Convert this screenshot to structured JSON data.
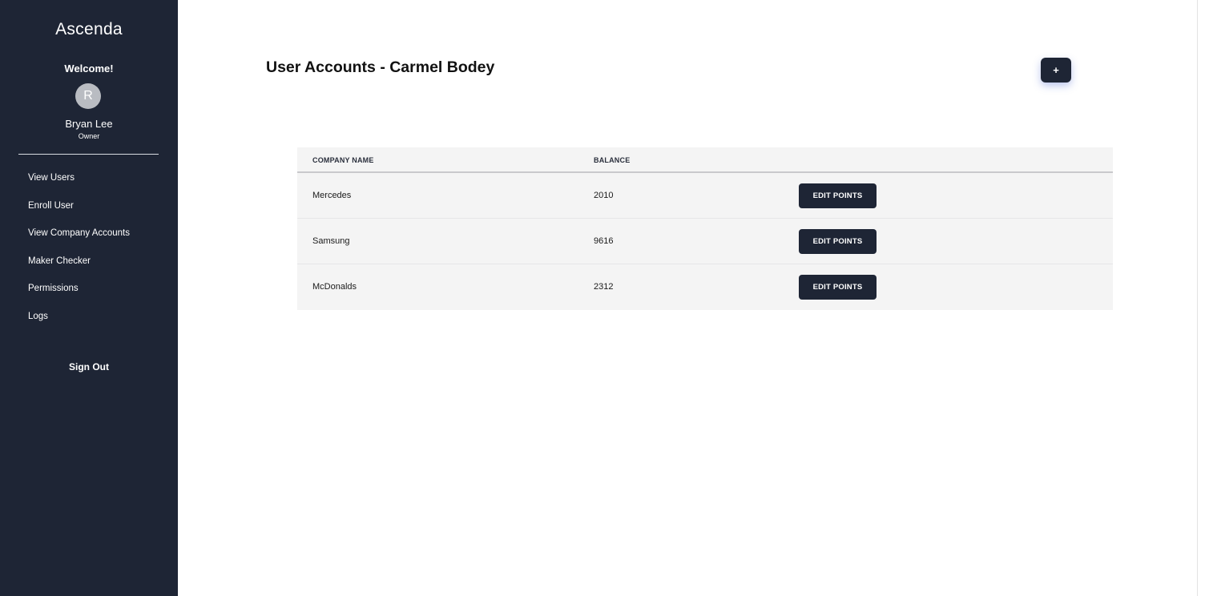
{
  "sidebar": {
    "logo": "Ascenda",
    "welcome": "Welcome!",
    "avatar_initial": "R",
    "user_name": "Bryan Lee",
    "user_role": "Owner",
    "nav_items": [
      {
        "label": "View Users"
      },
      {
        "label": "Enroll User"
      },
      {
        "label": "View Company Accounts"
      },
      {
        "label": "Maker Checker"
      },
      {
        "label": "Permissions"
      },
      {
        "label": "Logs"
      }
    ],
    "sign_out": "Sign Out"
  },
  "main": {
    "title": "User Accounts - Carmel Bodey",
    "add_button_label": "+",
    "table": {
      "headers": [
        "COMPANY NAME",
        "BALANCE"
      ],
      "rows": [
        {
          "company": "Mercedes",
          "balance": "2010",
          "action": "EDIT POINTS"
        },
        {
          "company": "Samsung",
          "balance": "9616",
          "action": "EDIT POINTS"
        },
        {
          "company": "McDonalds",
          "balance": "2312",
          "action": "EDIT POINTS"
        }
      ]
    }
  },
  "colors": {
    "sidebar_bg": "#1e2535",
    "button_bg": "#1e2535",
    "table_bg": "#f4f4f4"
  }
}
